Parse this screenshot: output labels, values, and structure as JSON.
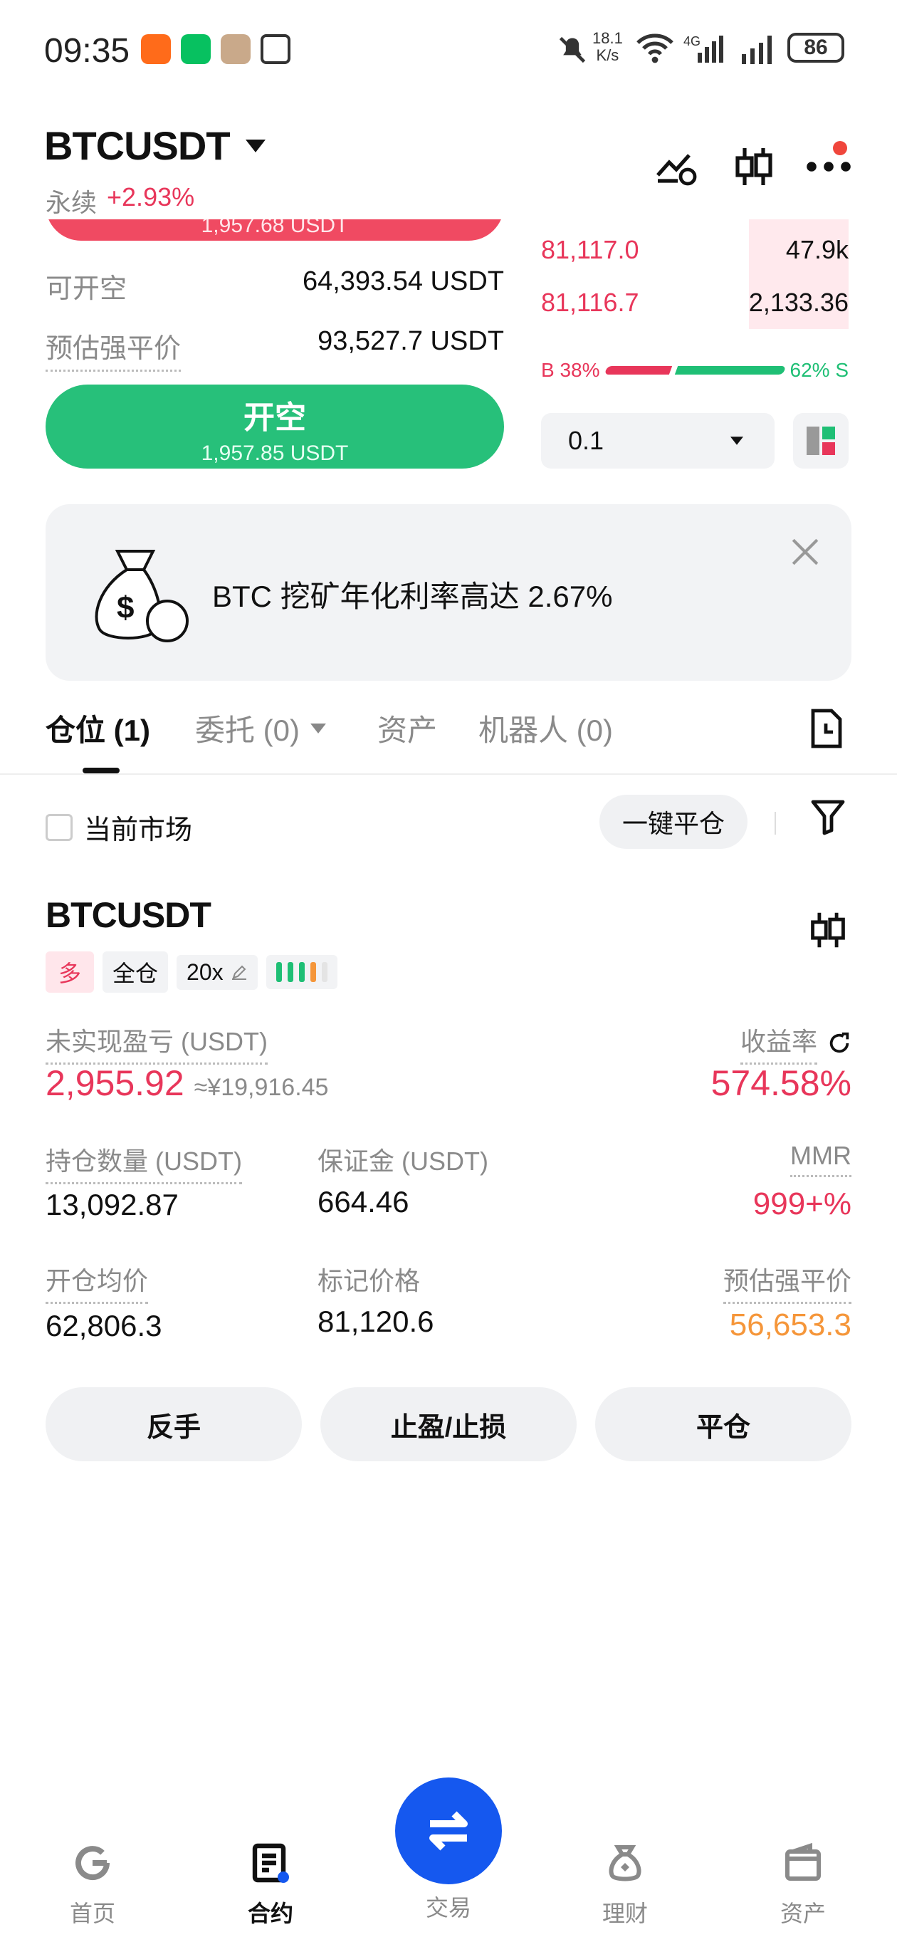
{
  "status_bar": {
    "time": "09:35",
    "net_speed_top": "18.1",
    "net_speed_bottom": "K/s",
    "battery": "86",
    "signal_tag": "4G",
    "wifi_tag": "6"
  },
  "header": {
    "symbol": "BTCUSDT",
    "contract_type": "永续",
    "change": "+2.93%"
  },
  "order_panel": {
    "top_button_price": "1,957.68 USDT",
    "available_short_label": "可开空",
    "available_short_value": "64,393.54 USDT",
    "liq_price_label": "预估强平价",
    "liq_price_value": "93,527.7 USDT",
    "open_short_label": "开空",
    "open_short_value": "1,957.85 USDT"
  },
  "orderbook": {
    "rows": [
      {
        "price": "81,117.0",
        "qty": "47.9k"
      },
      {
        "price": "81,116.7",
        "qty": "2,133.36"
      }
    ],
    "buy_label": "B 38%",
    "sell_label": "62% S",
    "buy_ratio": 0.38,
    "precision": "0.1"
  },
  "banner": {
    "text": "BTC 挖矿年化利率高达 2.67%"
  },
  "tabs": [
    {
      "label": "仓位 (1)",
      "active": true
    },
    {
      "label": "委托 (0)",
      "active": false
    },
    {
      "label": "资产",
      "active": false
    },
    {
      "label": "机器人 (0)",
      "active": false
    }
  ],
  "filter": {
    "current_market_label": "当前市场",
    "close_all_label": "一键平仓"
  },
  "position": {
    "symbol": "BTCUSDT",
    "side": "多",
    "margin_mode": "全仓",
    "leverage": "20x",
    "unrealized_pnl_label": "未实现盈亏 (USDT)",
    "unrealized_pnl_value": "2,955.92",
    "unrealized_pnl_cny": "≈¥19,916.45",
    "roe_label": "收益率",
    "roe_value": "574.58%",
    "size_label": "持仓数量 (USDT)",
    "size_value": "13,092.87",
    "margin_label": "保证金 (USDT)",
    "margin_value": "664.46",
    "mmr_label": "MMR",
    "mmr_value": "999+%",
    "entry_label": "开仓均价",
    "entry_value": "62,806.3",
    "mark_label": "标记价格",
    "mark_value": "81,120.6",
    "liq_label": "预估强平价",
    "liq_value": "56,653.3",
    "btn_reverse": "反手",
    "btn_tpsl": "止盈/止损",
    "btn_close": "平仓"
  },
  "bottom_nav": [
    {
      "label": "首页",
      "icon": "home-icon",
      "active": false
    },
    {
      "label": "合约",
      "icon": "contract-icon",
      "active": true
    },
    {
      "label": "交易",
      "icon": "trade-swap-icon",
      "active": false
    },
    {
      "label": "理财",
      "icon": "earn-icon",
      "active": false
    },
    {
      "label": "资产",
      "icon": "wallet-icon",
      "active": false
    }
  ],
  "colors": {
    "red": "#e8365a",
    "green": "#1fbf75",
    "orange": "#f5963a",
    "blue": "#1558ef"
  }
}
